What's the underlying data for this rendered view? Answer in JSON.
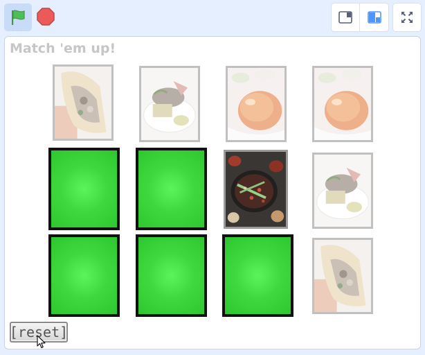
{
  "toolbar": {
    "green_flag_icon": "green-flag-icon",
    "stop_icon": "stop-sign-icon",
    "small_stage_icon": "small-stage-layout-icon",
    "large_stage_icon": "large-stage-layout-icon",
    "fullscreen_icon": "fullscreen-icon",
    "accent": "#4c97ff",
    "flag_color": "#4cbf56",
    "stop_color": "#ec5959"
  },
  "stage": {
    "title": "Match 'em up!",
    "reset_label": "[reset]",
    "card_back_color": "#3fd93f",
    "cards": [
      {
        "row": 1,
        "col": 1,
        "state": "revealed",
        "image": "taco-photo"
      },
      {
        "row": 1,
        "col": 2,
        "state": "revealed",
        "image": "fish-plate-photo"
      },
      {
        "row": 1,
        "col": 3,
        "state": "revealed",
        "image": "roast-duck-photo"
      },
      {
        "row": 1,
        "col": 4,
        "state": "revealed",
        "image": "roast-duck-photo"
      },
      {
        "row": 2,
        "col": 1,
        "state": "hidden"
      },
      {
        "row": 2,
        "col": 2,
        "state": "hidden"
      },
      {
        "row": 2,
        "col": 3,
        "state": "revealed",
        "image": "hotpot-photo"
      },
      {
        "row": 2,
        "col": 4,
        "state": "revealed",
        "image": "fish-plate-photo"
      },
      {
        "row": 3,
        "col": 1,
        "state": "hidden"
      },
      {
        "row": 3,
        "col": 2,
        "state": "hidden"
      },
      {
        "row": 3,
        "col": 3,
        "state": "hidden"
      },
      {
        "row": 3,
        "col": 4,
        "state": "revealed",
        "image": "taco-photo"
      }
    ]
  }
}
